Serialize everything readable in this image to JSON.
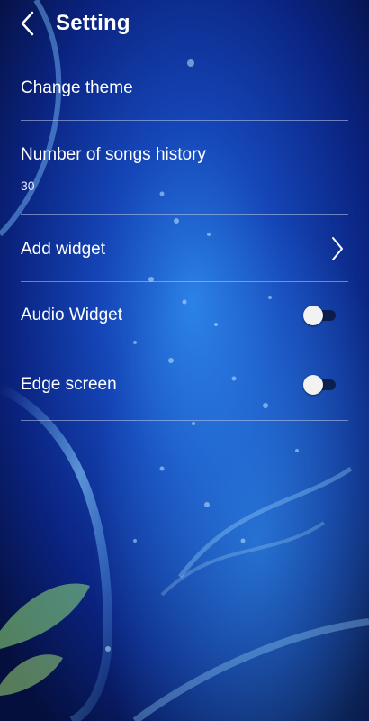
{
  "header": {
    "back_icon": "chevron-left-icon",
    "title": "Setting"
  },
  "settings": {
    "change_theme": {
      "label": "Change theme"
    },
    "songs_history": {
      "label": "Number of songs history",
      "value": "30"
    },
    "add_widget": {
      "label": "Add widget",
      "icon": "chevron-right-icon"
    },
    "audio_widget": {
      "label": "Audio Widget",
      "enabled": false
    },
    "edge_screen": {
      "label": "Edge screen",
      "enabled": false
    }
  },
  "colors": {
    "background_deep": "#061a5c",
    "background_glow": "#1f6fd6",
    "divider": "#bec8eb",
    "text": "#ffffff"
  }
}
